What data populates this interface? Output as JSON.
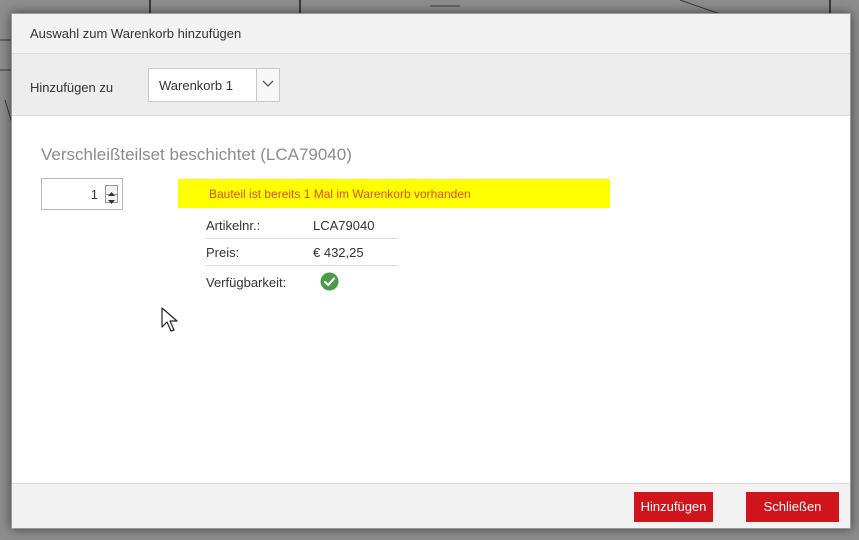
{
  "dialog": {
    "title": "Auswahl zum Warenkorb hinzufügen"
  },
  "toolbar": {
    "add_to_label": "Hinzufügen zu",
    "cart_select_value": "Warenkorb 1"
  },
  "part": {
    "title": "Verschleißteilset beschichtet (LCA79040)",
    "quantity": "1",
    "notice": "Bauteil ist bereits 1 Mal im Warenkorb vorhanden",
    "rows": [
      {
        "label": "Artikelnr.:",
        "value": "LCA79040"
      },
      {
        "label": "Preis:",
        "value": "€ 432,25"
      },
      {
        "label": "Verfügbarkeit:",
        "value": ""
      }
    ],
    "availability_icon": "check-circle-icon"
  },
  "footer": {
    "add_button": "Hinzufügen",
    "close_button": "Schließen"
  },
  "colors": {
    "accent_red": "#d0141c",
    "notice_bg": "#ffff00",
    "notice_text": "#d4521a",
    "available_green": "#4a9a4a"
  }
}
